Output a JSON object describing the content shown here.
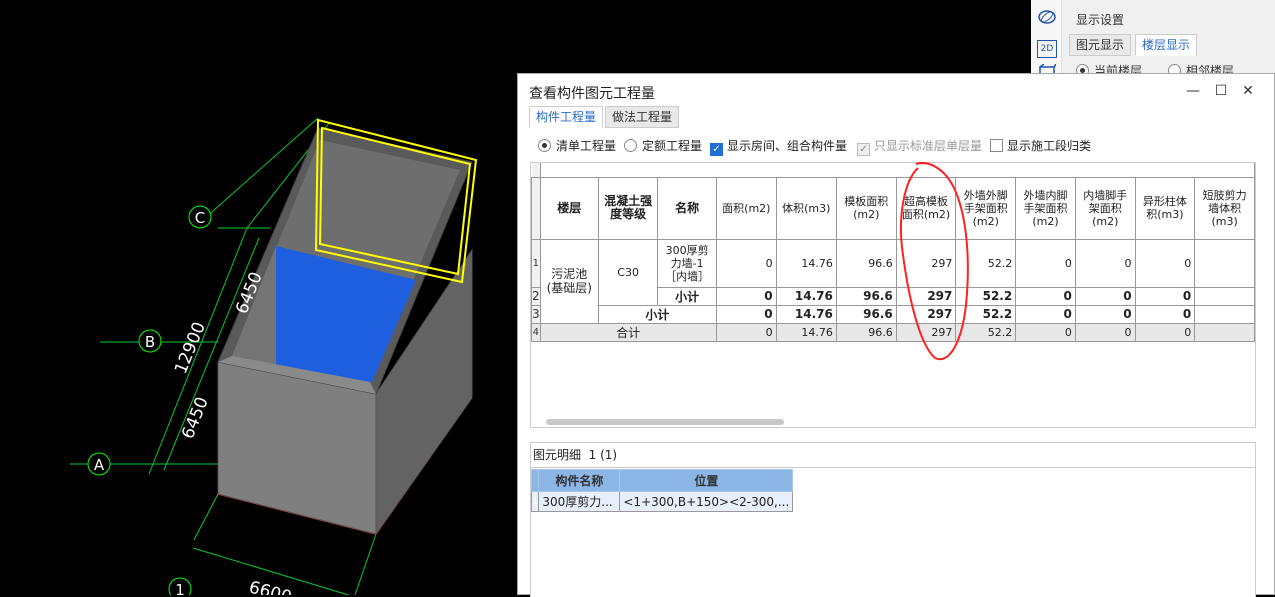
{
  "drawing": {
    "axes": [
      {
        "id": "C",
        "label": "C"
      },
      {
        "id": "B",
        "label": "B"
      },
      {
        "id": "A",
        "label": "A"
      },
      {
        "id": "1",
        "label": "1"
      }
    ],
    "dims": {
      "top_segment": "6450",
      "total": "12900",
      "bottom_segment": "6450",
      "width": "6600"
    },
    "colors": {
      "background": "#000000",
      "wall": "#7f7f7f",
      "selected_outline": "#ffff00",
      "highlight_wall": "#1e5fe0",
      "dim_line": "#00ff00",
      "axis_line": "#ff2020"
    }
  },
  "settings_panel": {
    "title": "显示设置",
    "tabs": [
      "图元显示",
      "楼层显示"
    ],
    "active_tab": "楼层显示",
    "radios": [
      "当前楼层",
      "相邻楼层"
    ],
    "tools": [
      "orbit-icon",
      "2D"
    ]
  },
  "dialog": {
    "title": "查看构件图元工程量",
    "tabs": [
      "构件工程量",
      "做法工程量"
    ],
    "options": {
      "qingdan": "清单工程量",
      "dinge": "定额工程量",
      "show_rooms": "显示房间、组合构件量",
      "std_floor": "只显示标准层单层量",
      "stage": "显示施工段归类"
    },
    "table": {
      "headers": {
        "floor": "楼层",
        "grade": "混凝土强度等级",
        "name": "名称",
        "cols": [
          "面积(m2)",
          "体积(m3)",
          "模板面积(m2)",
          "超高模板面积(m2)",
          "外墙外脚手架面积(m2)",
          "外墙内脚手架面积(m2)",
          "内墙脚手架面积(m2)",
          "异形柱体积(m3)",
          "短肢剪力墙体积(m3)"
        ]
      },
      "row_numbers": [
        "1",
        "2",
        "3",
        "4"
      ],
      "floor": "污泥池(基础层)",
      "grade": "C30",
      "name": "300厚剪力墙-1［内墙］",
      "subtotal_label": "小计",
      "total_label": "合计",
      "values": [
        "0",
        "14.76",
        "96.6",
        "297",
        "52.2",
        "0",
        "0",
        "0",
        ""
      ]
    },
    "detail": {
      "label": "图元明细",
      "count": "1 (1)",
      "headers": [
        "构件名称",
        "位置"
      ],
      "row_number": "1",
      "row": [
        "300厚剪力...",
        "<1+300,B+150><2-300,..."
      ]
    }
  }
}
